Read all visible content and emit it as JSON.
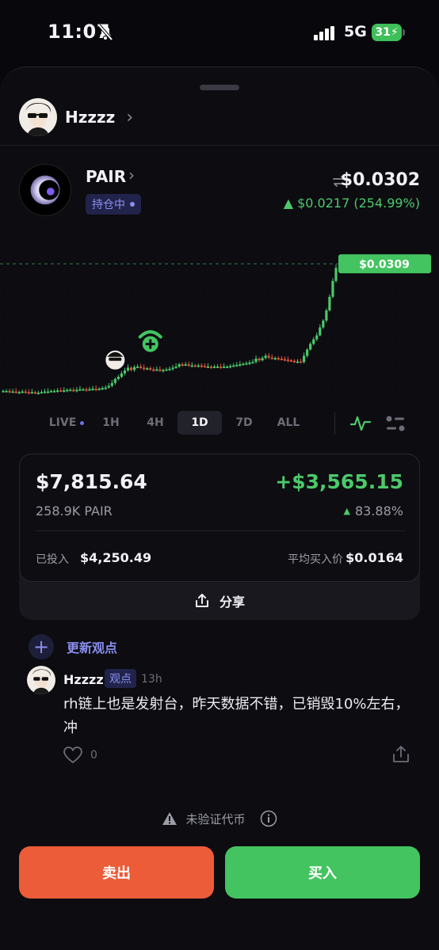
{
  "status_bar": {
    "time": "11:07",
    "network": "5G",
    "battery": "31"
  },
  "user": {
    "name": "Hzzzz"
  },
  "token": {
    "name": "PAIR",
    "holding_badge": "持仓中",
    "price": "$0.0302",
    "change": "▲ $0.0217 (254.99%)",
    "current_price_tag": "$0.0309"
  },
  "chart_data": {
    "type": "candlestick",
    "title": "",
    "current_price_label": "$0.0309",
    "colors": {
      "up": "#4cc96a",
      "down": "#e0533a"
    },
    "x": [
      1,
      2,
      3,
      4,
      5,
      6,
      7,
      8,
      9,
      10,
      11,
      12,
      13,
      14,
      15,
      16,
      17,
      18,
      19,
      20,
      21,
      22,
      23,
      24,
      25,
      26,
      27,
      28,
      29,
      30,
      31,
      32,
      33,
      34,
      35,
      36,
      37,
      38,
      39,
      40,
      41,
      42,
      43,
      44,
      45,
      46,
      47,
      48,
      49,
      50,
      51,
      52,
      53,
      54,
      55,
      56,
      57,
      58,
      59,
      60,
      61,
      62,
      63,
      64,
      65,
      66,
      67,
      68,
      69,
      70,
      71,
      72,
      73,
      74,
      75,
      76,
      77,
      78,
      79,
      80,
      81,
      82,
      83,
      84,
      85,
      86,
      87,
      88,
      89,
      90,
      91,
      92,
      93,
      94,
      95,
      96,
      97,
      98,
      99,
      100,
      101,
      102,
      103,
      104,
      105
    ],
    "close": [
      0.0085,
      0.0085,
      0.0084,
      0.0084,
      0.0083,
      0.0083,
      0.0084,
      0.0083,
      0.0082,
      0.0083,
      0.0082,
      0.0082,
      0.0083,
      0.0084,
      0.0084,
      0.0085,
      0.0085,
      0.0086,
      0.0085,
      0.0086,
      0.0087,
      0.0087,
      0.0086,
      0.0087,
      0.0088,
      0.0088,
      0.0087,
      0.0088,
      0.0089,
      0.0088,
      0.0089,
      0.009,
      0.0091,
      0.0094,
      0.0099,
      0.0106,
      0.011,
      0.0116,
      0.0121,
      0.0126,
      0.0122,
      0.0127,
      0.0128,
      0.0126,
      0.0124,
      0.0125,
      0.0123,
      0.0122,
      0.0123,
      0.0121,
      0.0122,
      0.0123,
      0.0124,
      0.0126,
      0.0128,
      0.0132,
      0.0131,
      0.0132,
      0.013,
      0.013,
      0.0129,
      0.013,
      0.0129,
      0.0128,
      0.0128,
      0.0127,
      0.0128,
      0.0128,
      0.0127,
      0.0128,
      0.0128,
      0.0129,
      0.013,
      0.0131,
      0.0132,
      0.0133,
      0.0134,
      0.0135,
      0.0136,
      0.0142,
      0.0139,
      0.0143,
      0.0147,
      0.0144,
      0.0142,
      0.0143,
      0.0142,
      0.0141,
      0.014,
      0.0139,
      0.0138,
      0.0137,
      0.0137,
      0.0136,
      0.0147,
      0.0158,
      0.0168,
      0.0176,
      0.0183,
      0.0197,
      0.0209,
      0.0227,
      0.0251,
      0.0279,
      0.0302
    ],
    "annotations": [
      "avatar-marker",
      "add-marker"
    ]
  },
  "ranges": [
    {
      "label": "LIVE",
      "live_dot": true
    },
    {
      "label": "1H"
    },
    {
      "label": "4H"
    },
    {
      "label": "1D",
      "active": true
    },
    {
      "label": "7D"
    },
    {
      "label": "ALL"
    }
  ],
  "position": {
    "value": "$7,815.64",
    "pnl": "+$3,565.15",
    "quantity": "258.9K PAIR",
    "pnl_pct": "83.88%",
    "invested_label": "已投入",
    "invested_value": "$4,250.49",
    "avg_label": "平均买入价",
    "avg_value": "$0.0164",
    "share_label": "分享"
  },
  "update_opinion": "更新观点",
  "post": {
    "author": "Hzzzz",
    "badge": "观点",
    "time": "13h",
    "text": "rh链上也是发射台，昨天数据不错，已销毁10%左右，冲",
    "likes": "0"
  },
  "unverified": "未验证代币",
  "actions": {
    "sell": "卖出",
    "buy": "买入"
  },
  "colors": {
    "accent": "#8a8ff0",
    "up": "#4cc96a",
    "down": "#e0533a",
    "sell": "#ec5c38",
    "buy": "#44c460"
  }
}
